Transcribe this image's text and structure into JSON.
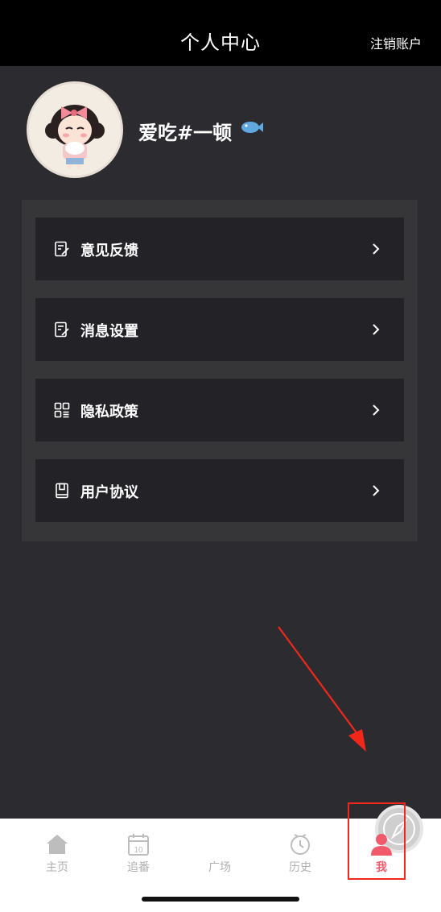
{
  "header": {
    "title": "个人中心",
    "action_label": "注销账户"
  },
  "profile": {
    "username": "爱吃#一顿",
    "avatar_icon": "cartoon-girl-avatar",
    "badge_icon": "fish-icon"
  },
  "menu": {
    "items": [
      {
        "label": "意见反馈",
        "icon": "edit-document-icon"
      },
      {
        "label": "消息设置",
        "icon": "edit-document-icon"
      },
      {
        "label": "隐私政策",
        "icon": "grid-list-icon"
      },
      {
        "label": "用户协议",
        "icon": "book-icon"
      }
    ]
  },
  "tabbar": {
    "tabs": [
      {
        "label": "主页",
        "icon": "home-icon",
        "active": false
      },
      {
        "label": "追番",
        "icon": "calendar-icon",
        "badge": "10",
        "active": false
      },
      {
        "label": "广场",
        "icon": "compass-icon",
        "active": false
      },
      {
        "label": "历史",
        "icon": "clock-icon",
        "active": false
      },
      {
        "label": "我",
        "icon": "person-icon",
        "active": true
      }
    ]
  },
  "colors": {
    "background": "#2c2c30",
    "header_bg": "#000000",
    "panel_bg": "#363638",
    "item_bg": "#232327",
    "active_tab": "#f05a6a",
    "annotation": "#f0271a"
  }
}
